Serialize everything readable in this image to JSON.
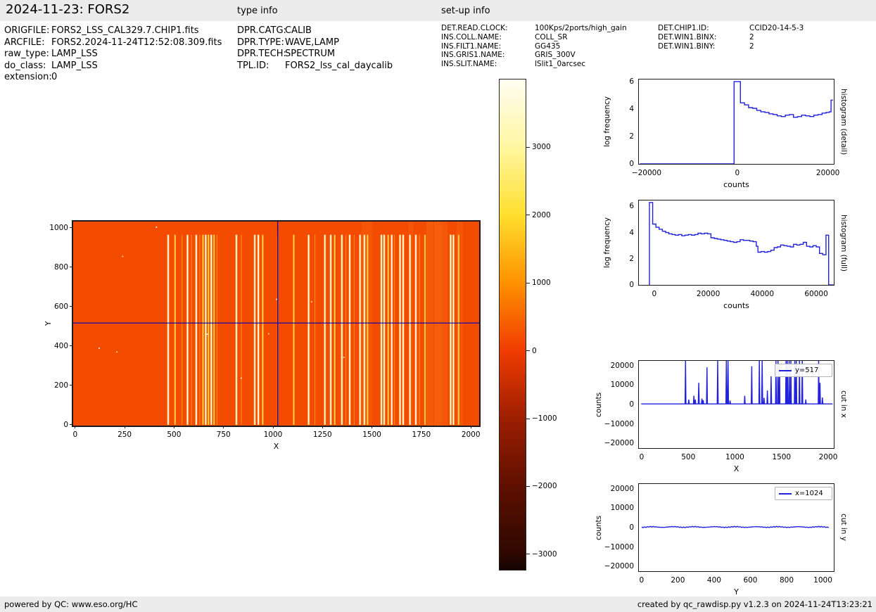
{
  "header": {
    "title": "2024-11-23: FORS2",
    "file_info": [
      {
        "label": "ORIGFILE:",
        "value": "FORS2_LSS_CAL329.7.CHIP1.fits"
      },
      {
        "label": "ARCFILE:",
        "value": "FORS2.2024-11-24T12:52:08.309.fits"
      },
      {
        "label": "raw_type:",
        "value": "LAMP_LSS"
      },
      {
        "label": "do_class:",
        "value": "LAMP_LSS"
      },
      {
        "label": "extension:",
        "value": "0"
      }
    ],
    "type_info": {
      "heading": "type info",
      "rows": [
        {
          "label": "DPR.CATG:",
          "value": "CALIB"
        },
        {
          "label": "DPR.TYPE:",
          "value": "WAVE,LAMP"
        },
        {
          "label": "DPR.TECH:",
          "value": "SPECTRUM"
        },
        {
          "label": "TPL.ID:",
          "value": "FORS2_lss_cal_daycalib"
        }
      ]
    },
    "setup_info": {
      "heading": "set-up info",
      "left_rows": [
        {
          "label": "DET.READ.CLOCK:",
          "value": "100Kps/2ports/high_gain"
        },
        {
          "label": "INS.COLL.NAME:",
          "value": "COLL_SR"
        },
        {
          "label": "INS.FILT1.NAME:",
          "value": "GG435"
        },
        {
          "label": "INS.GRIS1.NAME:",
          "value": "GRIS_300V"
        },
        {
          "label": "INS.SLIT.NAME:",
          "value": "lSlit1_0arcsec"
        }
      ],
      "right_rows": [
        {
          "label": "DET.CHIP1.ID:",
          "value": "CCID20-14-5-3"
        },
        {
          "label": "DET.WIN1.BINX:",
          "value": "2"
        },
        {
          "label": "DET.WIN1.BINY:",
          "value": "2"
        }
      ]
    }
  },
  "footer": {
    "left": "powered by QC: www.eso.org/HC",
    "right": "created by qc_rawdisp.py v1.2.3 on 2024-11-24T13:23:21"
  },
  "colors": {
    "line_blue": "#2222dd",
    "crosshair_blue": "#0000bb",
    "image_background": "#f34c00",
    "bar_background": "#ececec",
    "axes_border": "#1a1a1a"
  },
  "chart_data": [
    {
      "type": "heatmap",
      "name": "raw-image",
      "description": "FORS2 LAMP_LSS raw frame: bright vertical arc-lamp emission lines on orange background (hot colormap), blue crosshair cursor",
      "xlabel": "X",
      "ylabel": "Y",
      "xlim": [
        -10,
        2042
      ],
      "ylim": [
        -4,
        1032
      ],
      "xticks": [
        0,
        250,
        500,
        750,
        1000,
        1250,
        1500,
        1750,
        2000
      ],
      "yticks": [
        0,
        200,
        400,
        600,
        800,
        1000
      ],
      "crosshair": {
        "x": 1024,
        "y": 517
      },
      "line_y_extent": [
        0,
        965
      ],
      "emission_lines": [
        [
          470,
          "w"
        ],
        [
          505,
          "y"
        ],
        [
          540,
          "f"
        ],
        [
          568,
          "w"
        ],
        [
          588,
          "f"
        ],
        [
          612,
          "w"
        ],
        [
          630,
          "f"
        ],
        [
          646,
          "y"
        ],
        [
          660,
          "w"
        ],
        [
          674,
          "y"
        ],
        [
          688,
          "w"
        ],
        [
          702,
          "y"
        ],
        [
          717,
          "f"
        ],
        [
          815,
          "w"
        ],
        [
          840,
          "f"
        ],
        [
          908,
          "w"
        ],
        [
          926,
          "w"
        ],
        [
          948,
          "y"
        ],
        [
          1022,
          "f"
        ],
        [
          1105,
          "y"
        ],
        [
          1180,
          "w"
        ],
        [
          1212,
          "f"
        ],
        [
          1262,
          "w"
        ],
        [
          1292,
          "w"
        ],
        [
          1312,
          "y"
        ],
        [
          1348,
          "w"
        ],
        [
          1368,
          "f"
        ],
        [
          1388,
          "w"
        ],
        [
          1410,
          "f"
        ],
        [
          1440,
          "w"
        ],
        [
          1462,
          "w"
        ],
        [
          1478,
          "y"
        ],
        [
          1548,
          "w"
        ],
        [
          1562,
          "w"
        ],
        [
          1582,
          "y"
        ],
        [
          1600,
          "w"
        ],
        [
          1614,
          "f"
        ],
        [
          1642,
          "w"
        ],
        [
          1658,
          "w"
        ],
        [
          1692,
          "w"
        ],
        [
          1722,
          "w"
        ],
        [
          1740,
          "f"
        ],
        [
          1768,
          "y"
        ],
        [
          1898,
          "w"
        ],
        [
          1912,
          "w"
        ],
        [
          1938,
          "y"
        ]
      ],
      "bands": [
        [
          1447,
          1500,
          0.1
        ],
        [
          1688,
          1706,
          0.1
        ],
        [
          1775,
          1812,
          0.16
        ],
        [
          1815,
          1852,
          0.2
        ],
        [
          1854,
          1882,
          0.13
        ],
        [
          1928,
          1962,
          0.1
        ]
      ],
      "speckles": [
        [
          408,
          1007
        ],
        [
          237,
          858
        ],
        [
          118,
          392
        ],
        [
          208,
          373
        ],
        [
          1015,
          640
        ],
        [
          1355,
          345
        ],
        [
          836,
          240
        ],
        [
          1192,
          628
        ],
        [
          665,
          463
        ],
        [
          975,
          465
        ]
      ]
    },
    {
      "type": "colorbar",
      "name": "colorbar",
      "ticks": [
        3000,
        2000,
        1000,
        0,
        -1000,
        -2000,
        -3000
      ],
      "vmin": -3230,
      "vmax": 4000,
      "colormap_stops": [
        [
          0.0,
          "#150400"
        ],
        [
          0.032,
          "#2e0800"
        ],
        [
          0.17,
          "#5f1000"
        ],
        [
          0.308,
          "#9c1e00"
        ],
        [
          0.447,
          "#f03c00"
        ],
        [
          0.585,
          "#ff9100"
        ],
        [
          0.723,
          "#ffdf2e"
        ],
        [
          0.862,
          "#fff6a0"
        ],
        [
          1.0,
          "#fffdf2"
        ]
      ]
    },
    {
      "type": "line",
      "name": "histogram-detail",
      "right_label": "histogram (detail)",
      "ylabel": "log frequency",
      "xlabel": "counts",
      "xlim": [
        -21700,
        21300
      ],
      "ylim": [
        0,
        6.15
      ],
      "xticks": [
        -20000,
        0,
        20000
      ],
      "xminor": [
        -10000,
        10000
      ],
      "yticks": [
        0,
        2,
        4,
        6
      ],
      "points": [
        [
          -21500,
          0
        ],
        [
          -700,
          0
        ],
        [
          -700,
          6.0
        ],
        [
          700,
          6.0
        ],
        [
          700,
          4.45
        ],
        [
          1600,
          4.45
        ],
        [
          1600,
          4.3
        ],
        [
          2500,
          4.3
        ],
        [
          2500,
          4.1
        ],
        [
          3400,
          4.1
        ],
        [
          3400,
          4.05
        ],
        [
          4300,
          4.05
        ],
        [
          4300,
          3.9
        ],
        [
          5200,
          3.9
        ],
        [
          5200,
          3.8
        ],
        [
          6100,
          3.8
        ],
        [
          6100,
          3.75
        ],
        [
          7000,
          3.75
        ],
        [
          7000,
          3.65
        ],
        [
          7900,
          3.65
        ],
        [
          7900,
          3.6
        ],
        [
          8800,
          3.6
        ],
        [
          8800,
          3.5
        ],
        [
          9700,
          3.5
        ],
        [
          9700,
          3.45
        ],
        [
          10600,
          3.45
        ],
        [
          10600,
          3.55
        ],
        [
          11500,
          3.55
        ],
        [
          11500,
          3.6
        ],
        [
          12400,
          3.6
        ],
        [
          12400,
          3.4
        ],
        [
          13300,
          3.4
        ],
        [
          13300,
          3.45
        ],
        [
          14200,
          3.45
        ],
        [
          14200,
          3.55
        ],
        [
          15100,
          3.55
        ],
        [
          15100,
          3.5
        ],
        [
          16000,
          3.5
        ],
        [
          16000,
          3.45
        ],
        [
          16900,
          3.45
        ],
        [
          16900,
          3.55
        ],
        [
          17800,
          3.55
        ],
        [
          17800,
          3.6
        ],
        [
          18700,
          3.6
        ],
        [
          18700,
          3.7
        ],
        [
          19600,
          3.7
        ],
        [
          19600,
          3.75
        ],
        [
          20300,
          3.75
        ],
        [
          20300,
          3.8
        ],
        [
          20700,
          3.8
        ],
        [
          20700,
          4.65
        ],
        [
          21100,
          4.65
        ]
      ]
    },
    {
      "type": "line",
      "name": "histogram-full",
      "right_label": "histogram (full)",
      "ylabel": "log frequency",
      "xlabel": "counts",
      "xlim": [
        -5700,
        66500
      ],
      "ylim": [
        0,
        6.45
      ],
      "xticks": [
        0,
        20000,
        40000,
        60000
      ],
      "xminor": [
        10000,
        30000,
        50000
      ],
      "yticks": [
        0,
        2,
        4,
        6
      ],
      "points": [
        [
          -1800,
          0
        ],
        [
          -1800,
          6.3
        ],
        [
          -600,
          6.3
        ],
        [
          -600,
          4.65
        ],
        [
          600,
          4.65
        ],
        [
          600,
          4.4
        ],
        [
          1800,
          4.4
        ],
        [
          1800,
          4.25
        ],
        [
          3000,
          4.25
        ],
        [
          3000,
          4.1
        ],
        [
          4200,
          4.1
        ],
        [
          4200,
          4.0
        ],
        [
          5400,
          4.0
        ],
        [
          5400,
          3.9
        ],
        [
          6600,
          3.9
        ],
        [
          6600,
          3.85
        ],
        [
          7800,
          3.85
        ],
        [
          7800,
          3.8
        ],
        [
          9000,
          3.8
        ],
        [
          9000,
          3.85
        ],
        [
          10200,
          3.85
        ],
        [
          10200,
          3.75
        ],
        [
          11400,
          3.75
        ],
        [
          11400,
          3.8
        ],
        [
          12600,
          3.8
        ],
        [
          12600,
          3.85
        ],
        [
          13800,
          3.85
        ],
        [
          13800,
          3.8
        ],
        [
          15000,
          3.8
        ],
        [
          15000,
          3.85
        ],
        [
          16200,
          3.85
        ],
        [
          16200,
          3.95
        ],
        [
          17400,
          3.95
        ],
        [
          17400,
          3.9
        ],
        [
          18600,
          3.9
        ],
        [
          18600,
          3.95
        ],
        [
          19800,
          3.95
        ],
        [
          19800,
          3.9
        ],
        [
          21000,
          3.9
        ],
        [
          21000,
          3.6
        ],
        [
          22200,
          3.6
        ],
        [
          22200,
          3.55
        ],
        [
          23400,
          3.55
        ],
        [
          23400,
          3.5
        ],
        [
          24600,
          3.5
        ],
        [
          24600,
          3.45
        ],
        [
          25800,
          3.45
        ],
        [
          25800,
          3.4
        ],
        [
          27000,
          3.4
        ],
        [
          27000,
          3.35
        ],
        [
          28200,
          3.35
        ],
        [
          28200,
          3.3
        ],
        [
          29400,
          3.3
        ],
        [
          29400,
          3.25
        ],
        [
          30600,
          3.25
        ],
        [
          30600,
          3.3
        ],
        [
          31800,
          3.3
        ],
        [
          31800,
          3.45
        ],
        [
          33000,
          3.45
        ],
        [
          33000,
          3.4
        ],
        [
          34200,
          3.4
        ],
        [
          34200,
          3.4
        ],
        [
          35400,
          3.4
        ],
        [
          35400,
          3.35
        ],
        [
          36600,
          3.35
        ],
        [
          36600,
          3.3
        ],
        [
          37800,
          3.3
        ],
        [
          37800,
          2.95
        ],
        [
          38400,
          2.95
        ],
        [
          38400,
          2.5
        ],
        [
          39600,
          2.5
        ],
        [
          39600,
          2.55
        ],
        [
          40800,
          2.55
        ],
        [
          40800,
          2.5
        ],
        [
          42000,
          2.5
        ],
        [
          42000,
          2.55
        ],
        [
          43200,
          2.55
        ],
        [
          43200,
          2.65
        ],
        [
          44400,
          2.65
        ],
        [
          44400,
          2.85
        ],
        [
          45600,
          2.85
        ],
        [
          45600,
          2.9
        ],
        [
          46800,
          2.9
        ],
        [
          46800,
          3.05
        ],
        [
          48000,
          3.05
        ],
        [
          48000,
          3.0
        ],
        [
          49200,
          3.0
        ],
        [
          49200,
          2.95
        ],
        [
          50400,
          2.95
        ],
        [
          50400,
          2.9
        ],
        [
          51600,
          2.9
        ],
        [
          51600,
          3.1
        ],
        [
          52800,
          3.1
        ],
        [
          52800,
          3.05
        ],
        [
          54000,
          3.05
        ],
        [
          54000,
          3.1
        ],
        [
          55200,
          3.1
        ],
        [
          55200,
          3.25
        ],
        [
          56400,
          3.25
        ],
        [
          56400,
          2.95
        ],
        [
          57600,
          2.95
        ],
        [
          57600,
          2.9
        ],
        [
          58800,
          2.9
        ],
        [
          58800,
          3.0
        ],
        [
          60000,
          3.0
        ],
        [
          60000,
          2.9
        ],
        [
          61200,
          2.9
        ],
        [
          61200,
          2.4
        ],
        [
          62400,
          2.4
        ],
        [
          62400,
          2.3
        ],
        [
          63600,
          2.3
        ],
        [
          63600,
          3.8
        ],
        [
          64600,
          3.8
        ],
        [
          64600,
          0
        ],
        [
          66400,
          0
        ]
      ]
    },
    {
      "type": "line",
      "name": "cut-in-x",
      "right_label": "cut in x",
      "ylabel": "counts",
      "xlabel": "X",
      "legend": "y=517",
      "xlim": [
        -30,
        2060
      ],
      "ylim": [
        -22500,
        22500
      ],
      "xticks": [
        0,
        500,
        1000,
        1500,
        2000
      ],
      "yticks": [
        -20000,
        -10000,
        0,
        10000,
        20000
      ],
      "baseline": 300,
      "spikes": [
        [
          470,
          23000
        ],
        [
          505,
          2500
        ],
        [
          560,
          4500
        ],
        [
          575,
          2500
        ],
        [
          612,
          11200
        ],
        [
          646,
          3000
        ],
        [
          660,
          2200
        ],
        [
          700,
          19200
        ],
        [
          815,
          23000
        ],
        [
          908,
          23000
        ],
        [
          926,
          23000
        ],
        [
          948,
          2000
        ],
        [
          1105,
          4500
        ],
        [
          1180,
          19700
        ],
        [
          1262,
          23000
        ],
        [
          1292,
          23000
        ],
        [
          1312,
          3500
        ],
        [
          1348,
          7200
        ],
        [
          1388,
          14500
        ],
        [
          1440,
          23000
        ],
        [
          1462,
          23000
        ],
        [
          1478,
          21000
        ],
        [
          1548,
          23000
        ],
        [
          1562,
          23000
        ],
        [
          1582,
          23000
        ],
        [
          1600,
          23000
        ],
        [
          1642,
          23000
        ],
        [
          1658,
          23000
        ],
        [
          1692,
          23000
        ],
        [
          1722,
          23000
        ],
        [
          1760,
          2600
        ],
        [
          1898,
          23000
        ],
        [
          1912,
          11200
        ],
        [
          1938,
          3600
        ]
      ]
    },
    {
      "type": "line",
      "name": "cut-in-y",
      "right_label": "cut in y",
      "ylabel": "counts",
      "xlabel": "Y",
      "legend": "x=1024",
      "xlim": [
        -15,
        1060
      ],
      "ylim": [
        -22500,
        22500
      ],
      "xticks": [
        0,
        200,
        400,
        600,
        800,
        1000
      ],
      "yticks": [
        -20000,
        -10000,
        0,
        10000,
        20000
      ],
      "baseline": 300,
      "flat": true
    }
  ]
}
